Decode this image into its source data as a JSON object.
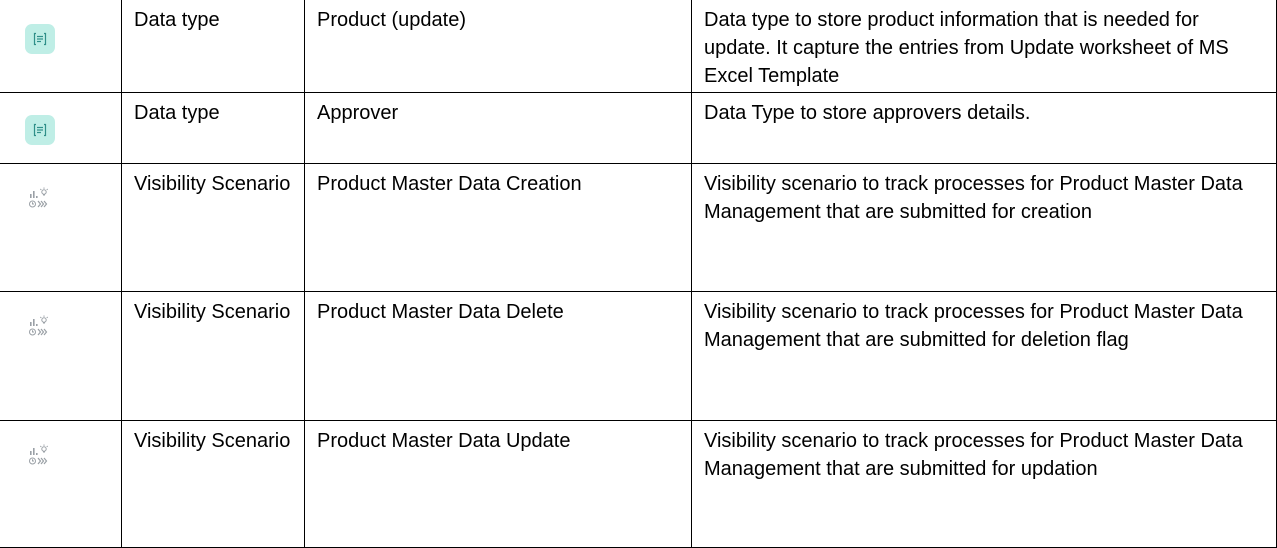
{
  "icons": {
    "data_type": "data-type-icon",
    "visibility_scenario": "visibility-scenario-icon"
  },
  "colors": {
    "data_type_icon_bg": "#bfeee6",
    "data_type_icon_fg": "#2f8f89",
    "visibility_icon_fg": "#9aa0a6",
    "border": "#000000"
  },
  "rows": [
    {
      "icon": "data-type-icon",
      "type": "Data type",
      "name": "Product (update)",
      "description": "Data type to store product information that is needed for update. It capture the entries from Update worksheet of MS Excel Template"
    },
    {
      "icon": "data-type-icon",
      "type": "Data type",
      "name": "Approver",
      "description": "Data Type to store approvers details."
    },
    {
      "icon": "visibility-scenario-icon",
      "type": "Visibility Scenario",
      "name": "Product Master Data Creation",
      "description": "Visibility scenario to track processes for Product Master Data Management that are submitted for creation"
    },
    {
      "icon": "visibility-scenario-icon",
      "type": "Visibility Scenario",
      "name": "Product Master Data Delete",
      "description": "Visibility scenario to track processes for Product Master Data Management that are submitted for deletion flag"
    },
    {
      "icon": "visibility-scenario-icon",
      "type": "Visibility Scenario",
      "name": "Product Master Data Update",
      "description": "Visibility scenario to track processes for Product Master Data Management that are submitted for updation"
    }
  ]
}
